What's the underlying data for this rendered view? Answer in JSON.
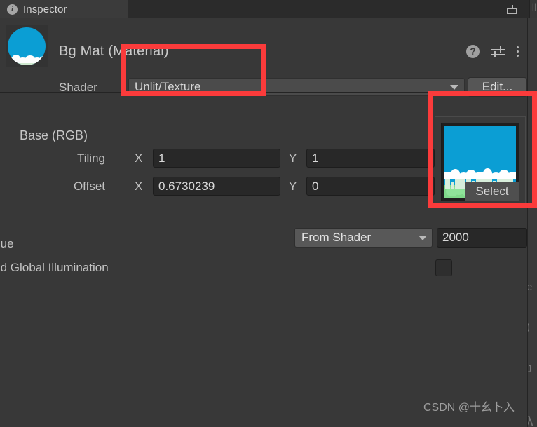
{
  "window": {
    "tab_label": "Inspector",
    "tab_icon": "info-circle-icon",
    "dock_icon": "dock-window-icon",
    "tab_menu_icon": "kebab-menu-icon",
    "edge_glyph": "||"
  },
  "header": {
    "title": "Bg Mat (Material)",
    "preview_icon": "material-sphere-preview",
    "help_icon": "help-question-icon",
    "preset_icon": "preset-sliders-icon",
    "menu_icon": "kebab-menu-icon"
  },
  "shader": {
    "label": "Shader",
    "value": "Unlit/Texture",
    "dropdown_icon": "chevron-down-icon",
    "edit_label": "Edit..."
  },
  "base_section": {
    "title": "Base (RGB)",
    "tiling": {
      "label": "Tiling",
      "x_axis": "X",
      "x_value": "1",
      "y_axis": "Y",
      "y_value": "1"
    },
    "offset": {
      "label": "Offset",
      "x_axis": "X",
      "x_value": "0.6730239",
      "y_axis": "Y",
      "y_value": "0"
    },
    "texture": {
      "select_label": "Select",
      "preview_icon": "texture-thumbnail-preview"
    }
  },
  "render_queue": {
    "label": "Render Queue",
    "mode": "From Shader",
    "dropdown_icon": "chevron-down-icon",
    "value": "2000"
  },
  "double_sided_gi": {
    "label": "Double Sided Global Illumination",
    "checked": false
  },
  "annotations": {
    "shader_highlight": "red-box-shader-field",
    "texture_highlight": "red-box-texture-preview",
    "color": "#fb3b3b"
  },
  "watermark": {
    "text": "CSDN @十幺卜入"
  },
  "right_panel_fragments": {
    "g1": "e",
    "g2": ")",
    "g3": "J",
    "g4": "λ"
  },
  "colors": {
    "background": "#383838",
    "tabbar": "#2b2b2b",
    "field_dark": "#282828",
    "field_light": "#4b4b4b",
    "sky": "#0b9ed4",
    "grass": "#7fd98a"
  }
}
